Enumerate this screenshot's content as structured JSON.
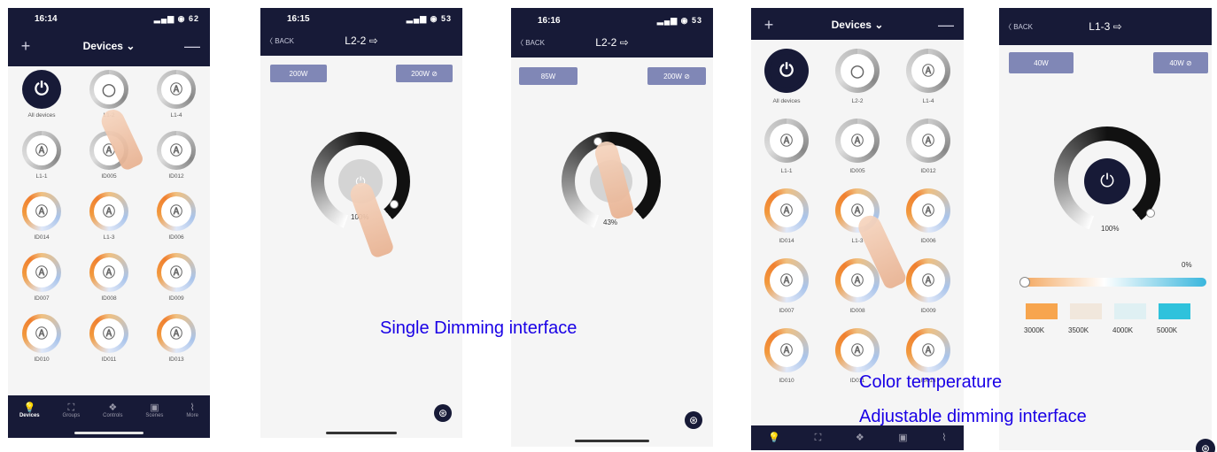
{
  "phone1": {
    "time": "16:14",
    "battery": "62",
    "header": {
      "title": "Devices ⌄",
      "plus": "+",
      "minus": "—"
    },
    "devices": [
      {
        "label": "All devices",
        "style": "dark",
        "glyph": "⏻"
      },
      {
        "label": "L1-2",
        "style": "grey",
        "glyph": "◯"
      },
      {
        "label": "L1-4",
        "style": "grey",
        "glyph": "Ⓐ"
      },
      {
        "label": "L1-1",
        "style": "grey",
        "glyph": "Ⓐ"
      },
      {
        "label": "ID005",
        "style": "grey",
        "glyph": "Ⓐ"
      },
      {
        "label": "ID012",
        "style": "grey",
        "glyph": "Ⓐ"
      },
      {
        "label": "ID014",
        "style": "warm",
        "glyph": "Ⓐ"
      },
      {
        "label": "L1-3",
        "style": "warm",
        "glyph": "Ⓐ"
      },
      {
        "label": "ID006",
        "style": "warm",
        "glyph": "Ⓐ"
      },
      {
        "label": "ID007",
        "style": "warm",
        "glyph": "Ⓐ"
      },
      {
        "label": "ID008",
        "style": "warm",
        "glyph": "Ⓐ"
      },
      {
        "label": "ID009",
        "style": "warm",
        "glyph": "Ⓐ"
      },
      {
        "label": "ID010",
        "style": "warm",
        "glyph": "Ⓐ"
      },
      {
        "label": "ID011",
        "style": "warm",
        "glyph": "Ⓐ"
      },
      {
        "label": "ID013",
        "style": "warm",
        "glyph": "Ⓐ"
      }
    ],
    "tabs": [
      {
        "label": "Devices",
        "icon": "bulb-icon",
        "glyph": "💡",
        "active": true
      },
      {
        "label": "Groups",
        "icon": "groups-icon",
        "glyph": "⛶",
        "active": false
      },
      {
        "label": "Controls",
        "icon": "controls-icon",
        "glyph": "❖",
        "active": false
      },
      {
        "label": "Scenes",
        "icon": "scenes-icon",
        "glyph": "▣",
        "active": false
      },
      {
        "label": "More",
        "icon": "more-icon",
        "glyph": "⌇",
        "active": false
      }
    ]
  },
  "phone2": {
    "time": "16:15",
    "battery": "53",
    "back": "〈 BACK",
    "title": "L2-2 ⇨",
    "btn_left": "200W",
    "btn_right": "200W ⊘",
    "percent": "100%"
  },
  "phone3": {
    "time": "16:16",
    "battery": "53",
    "back": "〈 BACK",
    "title": "L2-2 ⇨",
    "btn_left": "85W",
    "btn_right": "200W ⊘",
    "percent": "43%"
  },
  "phone4": {
    "header": {
      "title": "Devices ⌄",
      "plus": "+",
      "minus": "—"
    },
    "devices": [
      {
        "label": "All devices",
        "style": "dark",
        "glyph": "⏻"
      },
      {
        "label": "L2-2",
        "style": "grey",
        "glyph": "◯"
      },
      {
        "label": "L1-4",
        "style": "grey",
        "glyph": "Ⓐ"
      },
      {
        "label": "L1-1",
        "style": "grey",
        "glyph": "Ⓐ"
      },
      {
        "label": "ID005",
        "style": "grey",
        "glyph": "Ⓐ"
      },
      {
        "label": "ID012",
        "style": "grey",
        "glyph": "Ⓐ"
      },
      {
        "label": "ID014",
        "style": "warm",
        "glyph": "Ⓐ"
      },
      {
        "label": "L1-3",
        "style": "warm",
        "glyph": "Ⓐ"
      },
      {
        "label": "ID006",
        "style": "warm",
        "glyph": "Ⓐ"
      },
      {
        "label": "ID007",
        "style": "warm",
        "glyph": "Ⓐ"
      },
      {
        "label": "ID008",
        "style": "warm",
        "glyph": "Ⓐ"
      },
      {
        "label": "ID009",
        "style": "warm",
        "glyph": "Ⓐ"
      },
      {
        "label": "ID010",
        "style": "warm",
        "glyph": "Ⓐ"
      },
      {
        "label": "ID011",
        "style": "warm",
        "glyph": "Ⓐ"
      },
      {
        "label": "ID013",
        "style": "warm",
        "glyph": "Ⓐ"
      }
    ],
    "tab_glyphs": [
      "💡",
      "⛶",
      "❖",
      "▣",
      "⌇"
    ]
  },
  "phone5": {
    "back": "〈 BACK",
    "title": "L1-3 ⇨",
    "btn_left": "40W",
    "btn_right": "40W ⊘",
    "percent": "100%",
    "cct_percent": "0%",
    "swatches": [
      {
        "label": "3000K",
        "color": "#f7a54e"
      },
      {
        "label": "3500K",
        "color": "#f1e7dc"
      },
      {
        "label": "4000K",
        "color": "#dff0f3"
      },
      {
        "label": "5000K",
        "color": "#2fc2dc"
      }
    ]
  },
  "annotations": {
    "single": "Single Dimming interface",
    "color_temp": "Color temperature",
    "adjustable": "Adjustable dimming interface"
  },
  "colors": {
    "navy": "#171a37",
    "button": "#8087b6",
    "annotation": "#1900e6"
  }
}
